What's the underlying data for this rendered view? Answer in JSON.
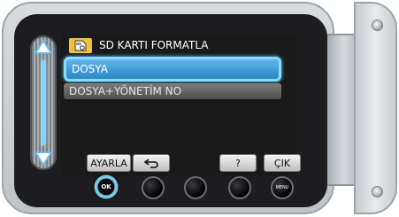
{
  "dialog": {
    "title": "SD KARTI FORMATLA",
    "icon": "sd-card-format-icon"
  },
  "options": [
    {
      "label": "DOSYA",
      "selected": true
    },
    {
      "label": "DOSYA+YÖNETİM NO",
      "selected": false
    }
  ],
  "softkeys": {
    "set": "AYARLA",
    "back_icon": "return-icon",
    "help": "?",
    "exit": "ÇIK"
  },
  "hardware_buttons": {
    "ok": "OK",
    "menu": "MENU"
  },
  "colors": {
    "highlight": "#2a86c6",
    "highlight_border": "#86dcff",
    "card_icon": "#f2c13a",
    "screen": "#1a1a1a"
  }
}
